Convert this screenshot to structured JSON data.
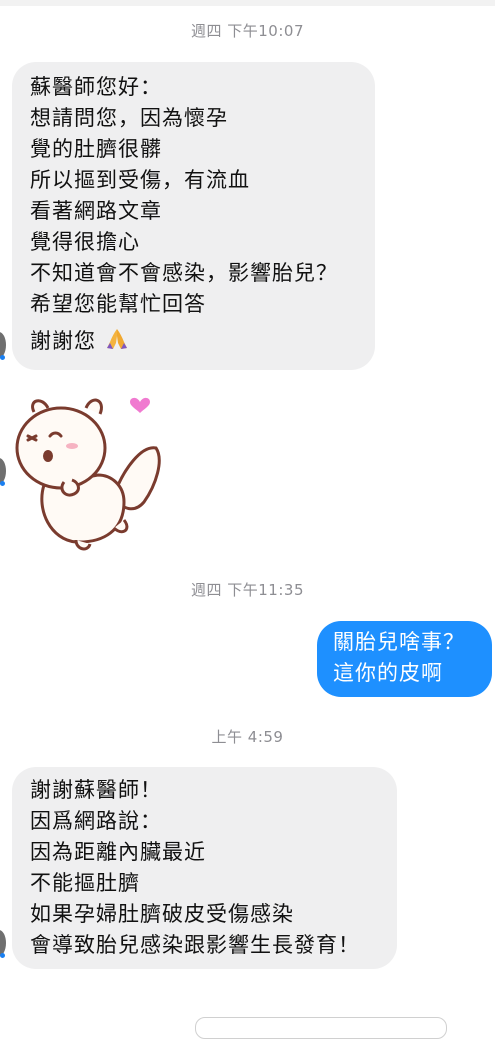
{
  "timestamps": {
    "t1": "週四 下午10:07",
    "t2": "週四 下午11:35",
    "t3": "上午 4:59"
  },
  "messages": {
    "incoming_1": {
      "lines": [
        "蘇醫師您好：",
        "想請問您，因為懷孕",
        "覺的肚臍很髒",
        "所以摳到受傷，有流血",
        "看著網路文章",
        "覺得很擔心",
        "不知道會不會感染，影響胎兒？",
        "希望您能幫忙回答",
        "謝謝您"
      ],
      "emoji": "pray-icon"
    },
    "sticker": {
      "name": "squirrel-sticker",
      "heart_color": "#f07ad0"
    },
    "outgoing_1": {
      "lines": [
        "關胎兒啥事？",
        "這你的皮啊"
      ]
    },
    "incoming_2": {
      "lines": [
        "謝謝蘇醫師！",
        "因爲網路說：",
        "因為距離內臟最近",
        "不能摳肚臍",
        "如果孕婦肚臍破皮受傷感染",
        "會導致胎兒感染跟影響生長發育！"
      ]
    }
  },
  "colors": {
    "incoming_bubble": "#efeff0",
    "outgoing_bubble": "#1e90ff",
    "timestamp": "#8e8e93"
  }
}
